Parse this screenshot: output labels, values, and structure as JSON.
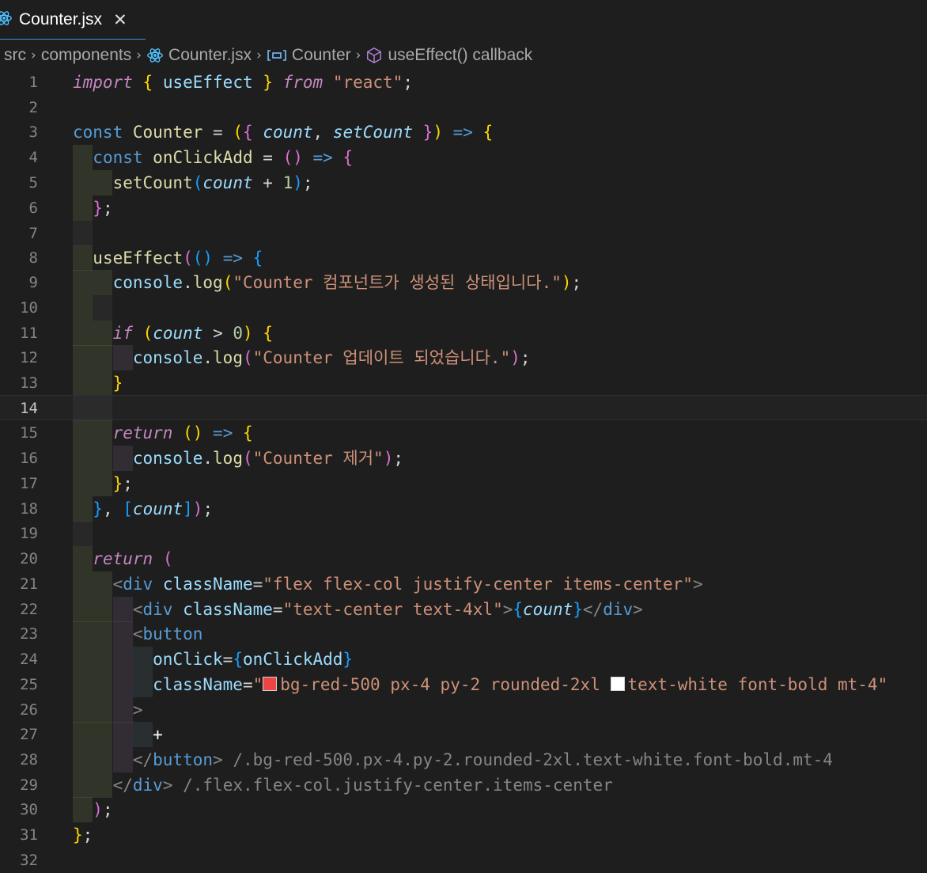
{
  "tab": {
    "label": "Counter.jsx",
    "icon": "react-icon",
    "close_icon": "close-icon"
  },
  "breadcrumb": {
    "items": [
      {
        "label": "src",
        "icon": ""
      },
      {
        "label": "components",
        "icon": ""
      },
      {
        "label": "Counter.jsx",
        "icon": "react-icon"
      },
      {
        "label": "Counter",
        "icon": "symbol-variable-icon"
      },
      {
        "label": "useEffect() callback",
        "icon": "symbol-method-icon"
      }
    ]
  },
  "editor": {
    "current_line": 14,
    "colors": {
      "background": "#1e1e1e",
      "keyword": "#569cd6",
      "string": "#ce9178",
      "function": "#dcdcaa",
      "variable": "#9cdcfe"
    },
    "lines": [
      {
        "n": "1",
        "text": "import { useEffect } from \"react\";"
      },
      {
        "n": "2",
        "text": ""
      },
      {
        "n": "3",
        "text": "const Counter = ({ count, setCount }) => {"
      },
      {
        "n": "4",
        "text": "  const onClickAdd = () => {"
      },
      {
        "n": "5",
        "text": "    setCount(count + 1);"
      },
      {
        "n": "6",
        "text": "  };"
      },
      {
        "n": "7",
        "text": ""
      },
      {
        "n": "8",
        "text": "  useEffect(() => {"
      },
      {
        "n": "9",
        "text": "    console.log(\"Counter 컴포넌트가 생성된 상태입니다.\");"
      },
      {
        "n": "10",
        "text": ""
      },
      {
        "n": "11",
        "text": "    if (count > 0) {"
      },
      {
        "n": "12",
        "text": "      console.log(\"Counter 업데이트 되었습니다.\");"
      },
      {
        "n": "13",
        "text": "    }"
      },
      {
        "n": "14",
        "text": ""
      },
      {
        "n": "15",
        "text": "    return () => {"
      },
      {
        "n": "16",
        "text": "      console.log(\"Counter 제거\");"
      },
      {
        "n": "17",
        "text": "    };"
      },
      {
        "n": "18",
        "text": "  }, [count]);"
      },
      {
        "n": "19",
        "text": ""
      },
      {
        "n": "20",
        "text": "  return ("
      },
      {
        "n": "21",
        "text": "    <div className=\"flex flex-col justify-center items-center\">"
      },
      {
        "n": "22",
        "text": "      <div className=\"text-center text-4xl\">{count}</div>"
      },
      {
        "n": "23",
        "text": "      <button"
      },
      {
        "n": "24",
        "text": "        onClick={onClickAdd}"
      },
      {
        "n": "25",
        "text": "        className=\"bg-red-500 px-4 py-2 rounded-2xl text-white font-bold mt-4\""
      },
      {
        "n": "26",
        "text": "      >"
      },
      {
        "n": "27",
        "text": "        +"
      },
      {
        "n": "28",
        "text": "      </button>"
      },
      {
        "n": "29",
        "text": "    </div>"
      },
      {
        "n": "30",
        "text": "  );"
      },
      {
        "n": "31",
        "text": "};"
      },
      {
        "n": "32",
        "text": ""
      }
    ],
    "inline_hints": {
      "line28": "/.bg-red-500.px-4.py-2.rounded-2xl.text-white.font-bold.mt-4",
      "line29": "/.flex.flex-col.justify-center.items-center"
    },
    "swatches": {
      "red": "#ef4444",
      "white": "#ffffff"
    }
  }
}
